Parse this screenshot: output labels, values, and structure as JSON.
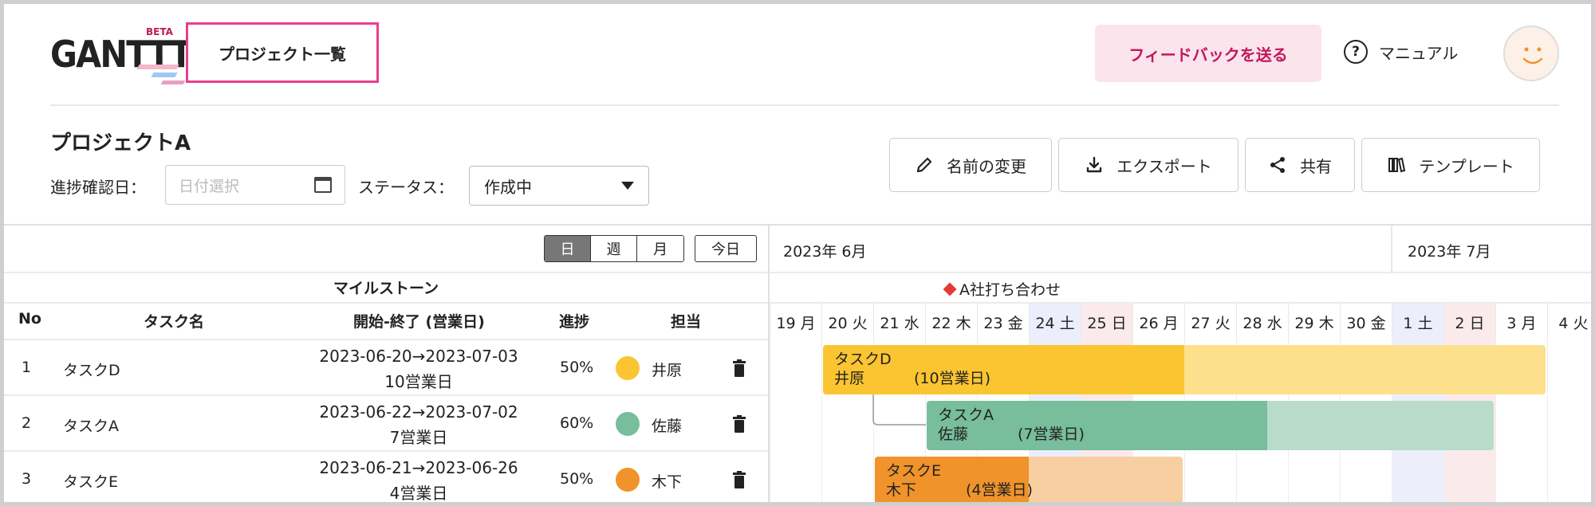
{
  "header": {
    "logo": "GANTTT",
    "beta": "BETA",
    "project_list": "プロジェクト一覧",
    "feedback": "フィードバックを送る",
    "manual": "マニュアル"
  },
  "project": {
    "title": "プロジェクトA",
    "date_label": "進捗確認日：",
    "date_placeholder": "日付選択",
    "status_label": "ステータス：",
    "status_value": "作成中",
    "actions": {
      "rename": "名前の変更",
      "export": "エクスポート",
      "share": "共有",
      "template": "テンプレート"
    }
  },
  "view": {
    "day": "日",
    "week": "週",
    "month": "月",
    "today": "今日"
  },
  "milestone": {
    "label": "マイルストーン",
    "item": "A社打ち合わせ"
  },
  "columns": {
    "no": "No",
    "task": "タスク名",
    "period": "開始-終了 (営業日)",
    "progress": "進捗",
    "assignee": "担当"
  },
  "tasks": [
    {
      "no": "1",
      "name": "タスクD",
      "range": "2023-06-20→2023-07-03",
      "days": "10営業日",
      "progress": "50%",
      "progress_value": 0.5,
      "assignee": "井原",
      "color": "#fbc531",
      "light": "#fde08c",
      "bar_days": "(10営業日)"
    },
    {
      "no": "2",
      "name": "タスクA",
      "range": "2023-06-22→2023-07-02",
      "days": "7営業日",
      "progress": "60%",
      "progress_value": 0.6,
      "assignee": "佐藤",
      "color": "#78bd9c",
      "light": "#b8dcc9",
      "bar_days": "(7営業日)"
    },
    {
      "no": "3",
      "name": "タスクE",
      "range": "2023-06-21→2023-06-26",
      "days": "4営業日",
      "progress": "50%",
      "progress_value": 0.5,
      "assignee": "木下",
      "color": "#f0932b",
      "light": "#f8cfa1",
      "bar_days": "(4営業日)"
    }
  ],
  "timeline": {
    "months": [
      "2023年 6月",
      "2023年 7月"
    ],
    "days": [
      "19 月",
      "20 火",
      "21 水",
      "22 木",
      "23 金",
      "24 土",
      "25 日",
      "26 月",
      "27 火",
      "28 水",
      "29 木",
      "30 金",
      "1 土",
      "2 日",
      "3 月",
      "4 火"
    ],
    "saturday_color": "#eceefc",
    "sunday_color": "#fbeaec"
  }
}
